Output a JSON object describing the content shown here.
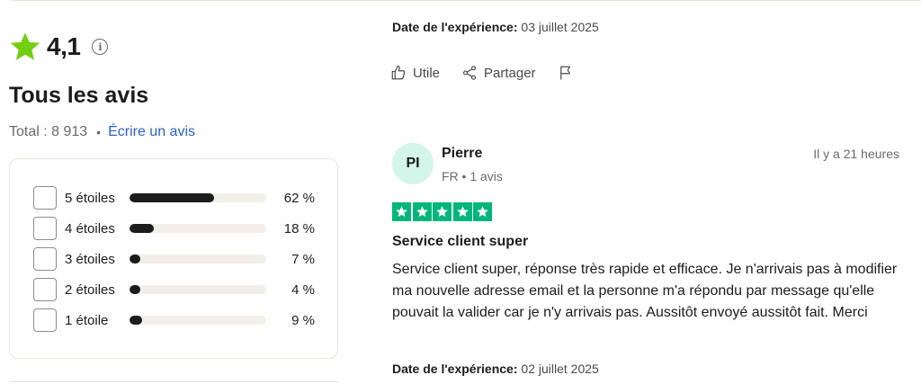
{
  "summary": {
    "rating": "4,1",
    "info_icon": "info-icon",
    "title": "Tous les avis",
    "total_label": "Total : 8 913",
    "separator": "•",
    "write_review_link": "Écrire un avis"
  },
  "distribution": [
    {
      "label": "5 étoiles",
      "percent_text": "62 %",
      "percent": 62
    },
    {
      "label": "4 étoiles",
      "percent_text": "18 %",
      "percent": 18
    },
    {
      "label": "3 étoiles",
      "percent_text": "7 %",
      "percent": 7
    },
    {
      "label": "2 étoiles",
      "percent_text": "4 %",
      "percent": 4
    },
    {
      "label": "1 étoile",
      "percent_text": "9 %",
      "percent": 9
    }
  ],
  "previous_review": {
    "experience_label": "Date de l'expérience:",
    "experience_date": "03 juillet 2025",
    "actions": {
      "useful": "Utile",
      "share": "Partager"
    }
  },
  "review": {
    "avatar_initials": "PI",
    "reviewer_name": "Pierre",
    "reviewer_meta": "FR • 1 avis",
    "time_ago": "Il y a 21 heures",
    "star_count": 5,
    "title": "Service client super",
    "body": "Service client super, réponse très rapide et efficace. Je n'arrivais pas à modifier ma nouvelle adresse email et la personne m'a répondu par message qu'elle pouvait la valider car je n'y arrivais pas. Aussitôt envoyé aussitôt fait. Merci",
    "experience_label": "Date de l'expérience:",
    "experience_date": "02 juillet 2025"
  },
  "colors": {
    "rating_star": "#73cf11",
    "trustpilot_green": "#00b67a",
    "link_blue": "#2c5fcf",
    "bar_fill": "#1c1c1c",
    "bar_track": "#f1efe8",
    "avatar_bg": "#d3f5ea"
  }
}
